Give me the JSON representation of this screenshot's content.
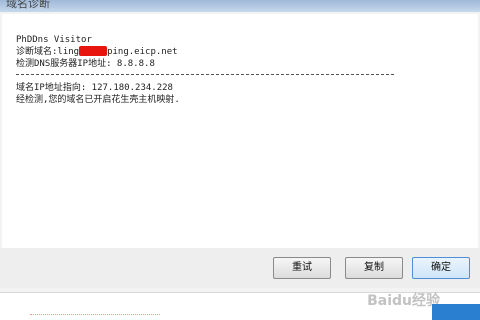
{
  "window": {
    "title": "域名诊断"
  },
  "console": {
    "line1": "PhDDns Visitor",
    "line2_prefix": "诊断域名:ling",
    "line2_suffix": "ping.eicp.net",
    "line3": "检测DNS服务器IP地址: 8.8.8.8",
    "line4": "域名IP地址指向: 127.180.234.228",
    "line5": "经检测,您的域名已开启花生壳主机映射."
  },
  "buttons": {
    "retry": "重试",
    "copy": "复制",
    "ok": "确定"
  },
  "watermark": {
    "text": "Baidu经验"
  },
  "colors": {
    "redaction": "#e8150f",
    "primary_button_border": "#4f8fd6"
  }
}
